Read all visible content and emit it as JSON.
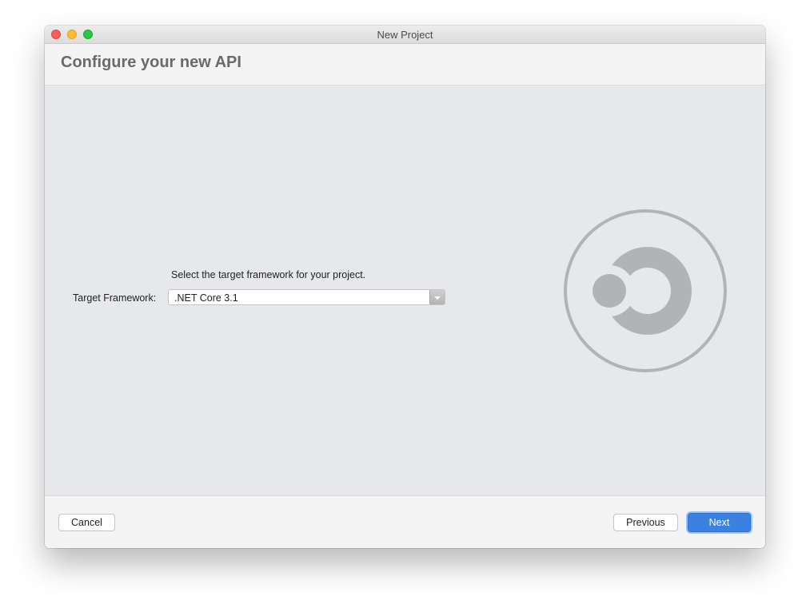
{
  "window": {
    "title": "New Project"
  },
  "header": {
    "title": "Configure your new API"
  },
  "form": {
    "instruction": "Select the target framework for your project.",
    "framework_label": "Target Framework:",
    "framework_value": ".NET Core 3.1"
  },
  "footer": {
    "cancel_label": "Cancel",
    "previous_label": "Previous",
    "next_label": "Next"
  },
  "colors": {
    "accent": "#3b82e0",
    "content_bg": "#e6e8ec",
    "logo_gray": "#b2b3b5"
  }
}
